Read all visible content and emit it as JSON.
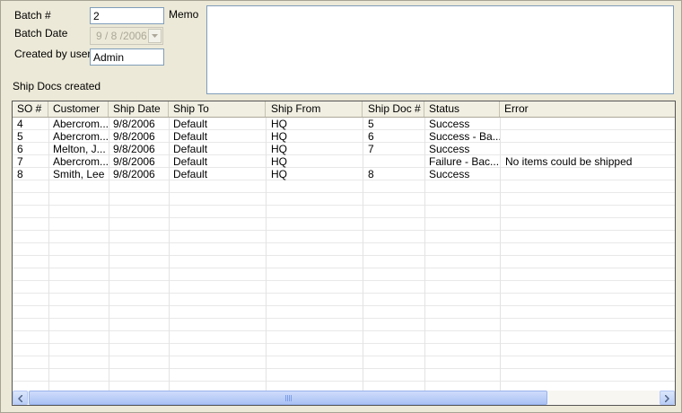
{
  "form": {
    "batch_label": "Batch #",
    "batch_value": "2",
    "batch_date_label": "Batch Date",
    "batch_date_value": "9 / 8 /2006",
    "created_by_label": "Created by user",
    "created_by_value": "Admin",
    "memo_label": "Memo",
    "memo_value": "",
    "ship_docs_label": "Ship Docs created"
  },
  "table": {
    "columns": [
      "SO #",
      "Customer",
      "Ship Date",
      "Ship To",
      "Ship From",
      "Ship Doc #",
      "Status",
      "Error"
    ],
    "rows": [
      [
        "4",
        "Abercrom...",
        "9/8/2006",
        "Default",
        "HQ",
        "5",
        "Success",
        ""
      ],
      [
        "5",
        "Abercrom...",
        "9/8/2006",
        "Default",
        "HQ",
        "6",
        "Success - Ba...",
        ""
      ],
      [
        "6",
        "Melton, J...",
        "9/8/2006",
        "Default",
        "HQ",
        "7",
        "Success",
        ""
      ],
      [
        "7",
        "Abercrom...",
        "9/8/2006",
        "Default",
        "HQ",
        "",
        "Failure - Bac...",
        "No items could be shipped"
      ],
      [
        "8",
        "Smith, Lee",
        "9/8/2006",
        "Default",
        "HQ",
        "8",
        "Success",
        ""
      ]
    ]
  },
  "colors": {
    "window_bg": "#ece9d8",
    "input_border": "#7f9db9",
    "scroll_thumb": "#b9cdf5"
  },
  "icons": {
    "date_dropdown": "chevron-down-icon",
    "scroll_left": "arrow-left-icon",
    "scroll_right": "arrow-right-icon"
  }
}
